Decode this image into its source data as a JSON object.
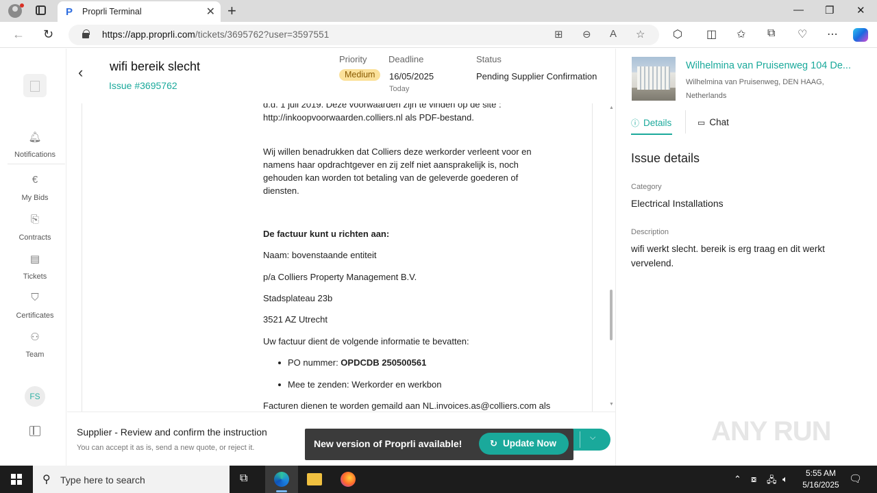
{
  "browser": {
    "tab_title": "Proprli Terminal",
    "tab_favicon": "P",
    "url_host": "https://app.proprli.com",
    "url_path": "/tickets/3695762?user=3597551"
  },
  "sidebar": {
    "items": [
      {
        "label": "Notifications",
        "icon": "bell-icon"
      },
      {
        "label": "My Bids",
        "icon": "euro-icon"
      },
      {
        "label": "Contracts",
        "icon": "document-icon"
      },
      {
        "label": "Tickets",
        "icon": "ticket-icon"
      },
      {
        "label": "Certificates",
        "icon": "shield-icon"
      },
      {
        "label": "Team",
        "icon": "team-icon"
      }
    ],
    "avatar_initials": "FS"
  },
  "issue": {
    "title": "wifi bereik slecht",
    "number": "Issue #3695762",
    "priority_label": "Priority",
    "priority_value": "Medium",
    "deadline_label": "Deadline",
    "deadline_value": "16/05/2025",
    "deadline_sub": "Today",
    "status_label": "Status",
    "status_value": "Pending Supplier Confirmation"
  },
  "document": {
    "lines": [
      "d.d. 1 juli 2019. Deze voorwaarden zijn te vinden op de site :",
      "http://inkoopvoorwaarden.colliers.nl als PDF-bestand.",
      "Wij willen benadrukken dat Colliers deze werkorder verleent voor en",
      "namens haar opdrachtgever en zij zelf niet aansprakelijk is, noch",
      "gehouden kan worden tot betaling van de geleverde goederen of",
      "diensten.",
      "De factuur kunt u richten aan:",
      "Naam: bovenstaande entiteit",
      "p/a Colliers Property Management B.V.",
      "Stadsplateau 23b",
      "3521 AZ Utrecht",
      "Uw factuur dient de volgende informatie te bevatten:",
      "Facturen dienen te worden gemaild aan NL.invoices.as@colliers.com als"
    ],
    "bullet1_label": "PO nummer: ",
    "bullet1_value": "OPDCDB 250500561",
    "bullet2": "Mee te zenden: Werkorder en werkbon"
  },
  "footer": {
    "title": "Supplier - Review and confirm the instruction",
    "subtitle": "You can accept it as is, send a new quote, or reject it."
  },
  "toast": {
    "text": "New version of Proprli available!",
    "button": "Update Now"
  },
  "property": {
    "title": "Wilhelmina van Pruisenweg 104 De...",
    "address_line1": "Wilhelmina van Pruisenweg, DEN HAAG,",
    "address_line2": "Netherlands"
  },
  "right_tabs": [
    {
      "label": "Details",
      "icon": "info-icon",
      "active": true
    },
    {
      "label": "Chat",
      "icon": "chat-icon",
      "active": false
    }
  ],
  "details": {
    "heading": "Issue details",
    "category_label": "Category",
    "category_value": "Electrical Installations",
    "description_label": "Description",
    "description_value": "wifi werkt slecht. bereik is erg traag en dit werkt vervelend."
  },
  "watermark": "ANY RUN",
  "taskbar": {
    "search_placeholder": "Type here to search",
    "time": "5:55 AM",
    "date": "5/16/2025"
  },
  "colors": {
    "accent": "#1aa99b",
    "priority_badge": "#fbe19a",
    "toast_bg": "#3b3b3b"
  }
}
